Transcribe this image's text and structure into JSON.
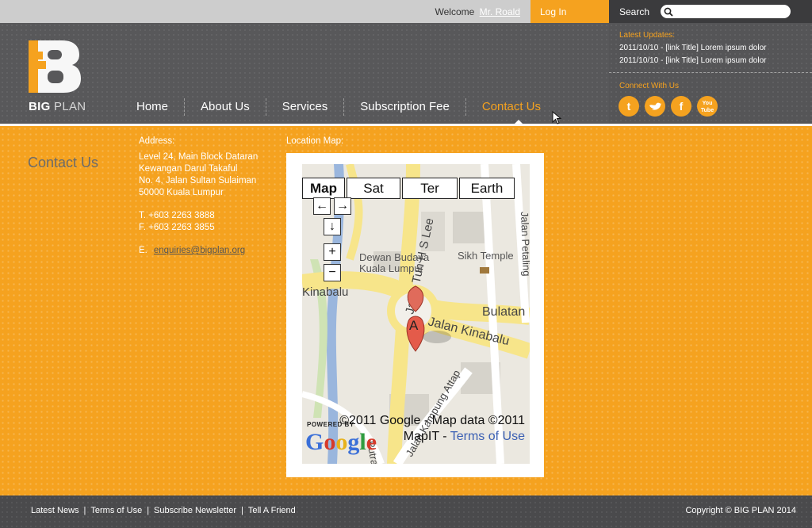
{
  "topbar": {
    "welcome_text": "Welcome",
    "user_name": "Mr. Roald",
    "login_label": "Log In",
    "search_label": "Search",
    "search_placeholder": ""
  },
  "brand": {
    "name_bold": "BIG",
    "name_light": "PLAN",
    "accent_color": "#f5a21f"
  },
  "nav": {
    "items": [
      {
        "label": "Home"
      },
      {
        "label": "About Us"
      },
      {
        "label": "Services"
      },
      {
        "label": "Subscription Fee"
      },
      {
        "label": "Contact Us"
      }
    ],
    "active": "Contact Us"
  },
  "updates": {
    "title": "Latest Updates:",
    "items": [
      "2011/10/10 - [link Title] Lorem ipsum dolor",
      "2011/10/10 - [link Title] Lorem ipsum dolor"
    ],
    "connect_title": "Connect With Us",
    "social": [
      {
        "icon": "twitter-icon",
        "glyph": "t"
      },
      {
        "icon": "bird-icon",
        "glyph": "🐦"
      },
      {
        "icon": "facebook-icon",
        "glyph": "f"
      },
      {
        "icon": "youtube-icon",
        "glyph": "You Tube"
      }
    ]
  },
  "content": {
    "heading": "Contact Us",
    "address_label": "Address:",
    "address_lines": [
      "Level 24, Main Block Dataran",
      "Kewangan Darul Takaful",
      "No. 4, Jalan Sultan Sulaiman",
      "50000 Kuala Lumpur"
    ],
    "phone": "T. +603 2263 3888",
    "fax": "F. +603 2263 3855",
    "email_prefix": "E.",
    "email": "enquiries@bigplan.org",
    "map_label": "Location Map:"
  },
  "map": {
    "types": [
      "Map",
      "Sat",
      "Ter",
      "Earth"
    ],
    "selected_type": "Map",
    "controls": {
      "left": "←",
      "right": "→",
      "down": "↓",
      "zoom_in": "+",
      "zoom_out": "−"
    },
    "marker_label": "A",
    "street_labels": [
      "Jalan Tun H S Lee",
      "Jalan Kinabalu",
      "Bulatan",
      "Kinabalu",
      "Jalan Petaling",
      "Sikh Temple",
      "Dewan Budaya",
      "Kuala Lumpur",
      "Jalan Kampung Attap",
      "Putra"
    ],
    "attribution": "©2011 Google - Map data ©2011 MapIT -",
    "terms_link": "Terms of Use",
    "powered_by": "POWERED BY",
    "google_logo": "Google"
  },
  "footer": {
    "links": [
      "Latest News",
      "Terms of Use",
      "Subscribe Newsletter",
      "Tell A Friend"
    ],
    "copyright": "Copyright © BIG PLAN 2014"
  }
}
